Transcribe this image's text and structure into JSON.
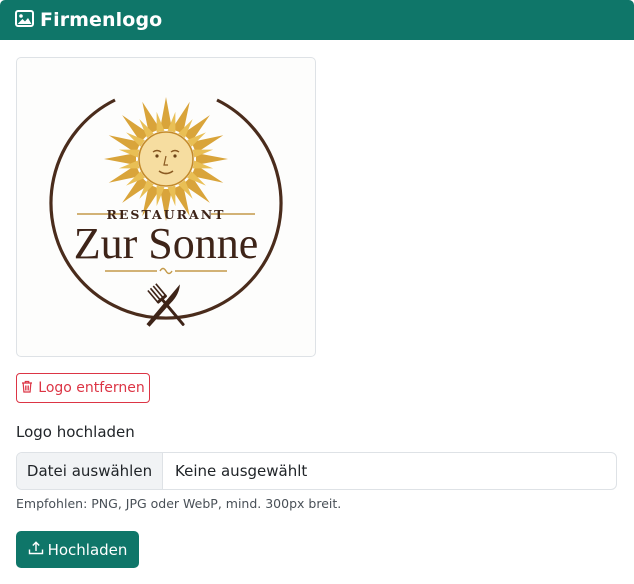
{
  "header": {
    "title": "Firmenlogo",
    "icon": "image-icon",
    "background": "#0f7669"
  },
  "logo": {
    "kicker": "RESTAURANT",
    "name": "Zur Sonne",
    "icons": [
      "sun-icon",
      "fork-icon",
      "knife-icon"
    ],
    "colors": {
      "gold": "#d9a43a",
      "brown": "#3e2418",
      "ring": "#4a2c1c"
    }
  },
  "actions": {
    "remove_label": "Logo entfernen",
    "remove_icon": "trash-icon",
    "remove_color": "#dc3545"
  },
  "upload": {
    "label": "Logo hochladen",
    "choose_label": "Datei auswählen",
    "no_file_label": "Keine ausgewählt",
    "help": "Empfohlen: PNG, JPG oder WebP, mind. 300px breit.",
    "submit_label": "Hochladen",
    "submit_icon": "upload-icon"
  }
}
